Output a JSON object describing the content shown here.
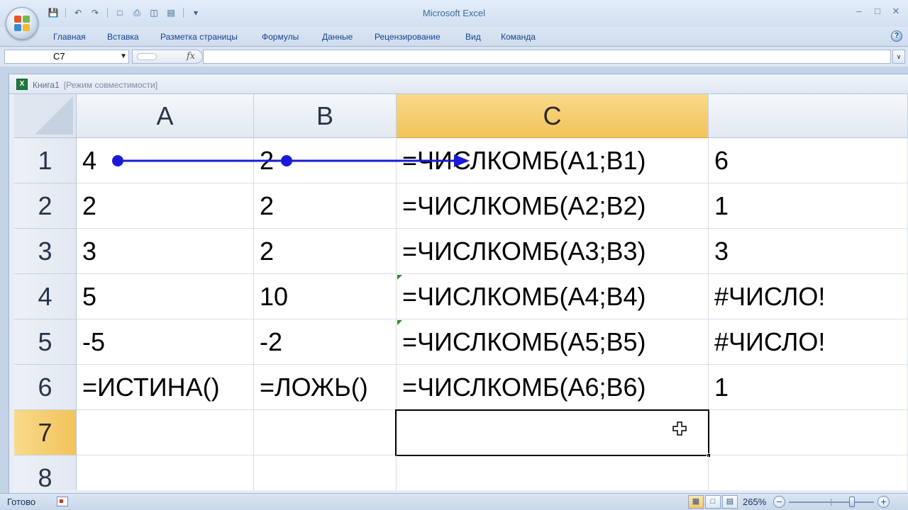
{
  "app": {
    "title": "Microsoft Excel"
  },
  "quick_access": {
    "icons": [
      "save-icon",
      "undo-icon",
      "redo-icon",
      "new-document-icon",
      "print-icon",
      "print-preview-icon",
      "sort-icon",
      "customize-dropdown-icon"
    ]
  },
  "ribbon": {
    "tabs": [
      "Главная",
      "Вставка",
      "Разметка страницы",
      "Формулы",
      "Данные",
      "Рецензирование",
      "Вид",
      "Команда"
    ],
    "help_glyph": "?"
  },
  "formula_bar": {
    "name_box": "C7",
    "fx_label": "fx",
    "formula": ""
  },
  "workbook": {
    "name": "Книга1",
    "mode": "[Режим совместимости]",
    "icon_letter": "X"
  },
  "sheet": {
    "columns": [
      "A",
      "B",
      "C",
      ""
    ],
    "rows": [
      "1",
      "2",
      "3",
      "4",
      "5",
      "6",
      "7",
      "8"
    ],
    "active_column": "C",
    "active_row": "7",
    "cells": {
      "A1": "4",
      "B1": "2",
      "C1": "=ЧИСЛКОМБ(A1;B1)",
      "D1": "6",
      "A2": "2",
      "B2": "2",
      "C2": "=ЧИСЛКОМБ(A2;B2)",
      "D2": "1",
      "A3": "3",
      "B3": "2",
      "C3": "=ЧИСЛКОМБ(A3;B3)",
      "D3": "3",
      "A4": "5",
      "B4": "10",
      "C4": "=ЧИСЛКОМБ(A4;B4)",
      "D4": "#ЧИСЛО!",
      "A5": "-5",
      "B5": "-2",
      "C5": "=ЧИСЛКОМБ(A5;B5)",
      "D5": "#ЧИСЛО!",
      "A6": "=ИСТИНА()",
      "B6": "=ЛОЖЬ()",
      "C6": "=ЧИСЛКОМБ(A6;B6)",
      "D6": "1",
      "A7": "",
      "B7": "",
      "C7": "",
      "D7": "",
      "A8": "",
      "B8": "",
      "C8": "",
      "D8": ""
    },
    "error_indicator_cells": [
      "C4",
      "C5"
    ],
    "trace_arrow_color": "#1a1ad6"
  },
  "status_bar": {
    "status": "Готово",
    "zoom": "265%",
    "zoom_minus": "−",
    "zoom_plus": "+"
  },
  "colors": {
    "active_header": "#f2c35b",
    "ribbon_text": "#15428b",
    "title_text": "#3f6a9b"
  }
}
